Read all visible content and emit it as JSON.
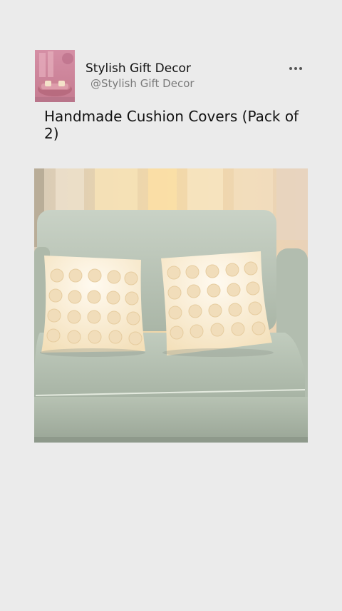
{
  "profile": {
    "name": "Stylish Gift Decor",
    "handle": "@Stylish Gift Decor",
    "avatar_icon": "sofa-thumbnail-icon"
  },
  "actions": {
    "more_icon": "more-horizontal-icon"
  },
  "post": {
    "title": "Handmade Cushion Covers (Pack of 2)",
    "image_icon": "sofa-with-cushions-photo"
  },
  "colors": {
    "background": "#ebebeb",
    "title_text": "#111111",
    "handle_text": "#7a7a7a",
    "sofa": "#b9c4b7",
    "cushion": "#fff3dc"
  }
}
